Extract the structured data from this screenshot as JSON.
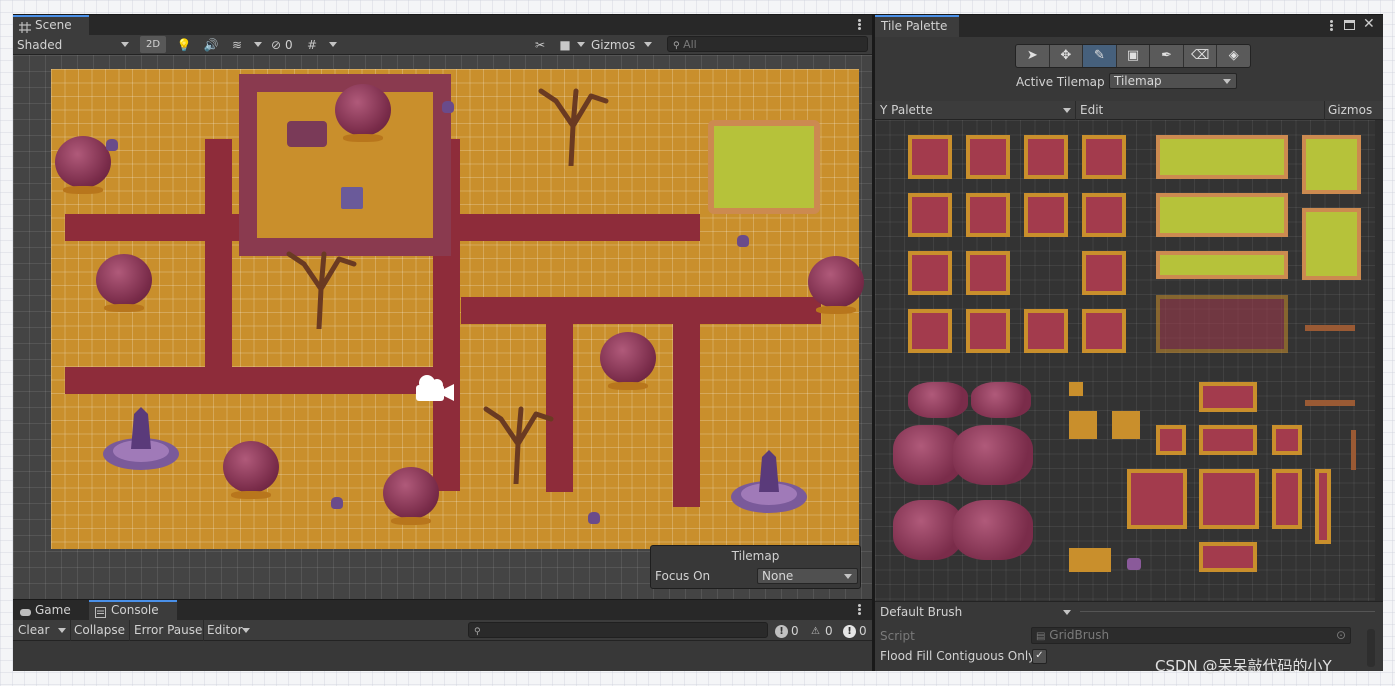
{
  "scene": {
    "tab_label": "Scene",
    "shading_mode": "Shaded",
    "btn_2d": "2D",
    "hidden_count": "0",
    "gizmos_label": "Gizmos",
    "search_placeholder": "All",
    "overlay": {
      "title": "Tilemap",
      "focus_label": "Focus On",
      "focus_value": "None"
    }
  },
  "console": {
    "tabs": [
      "Game",
      "Console"
    ],
    "clear": "Clear",
    "collapse": "Collapse",
    "error_pause": "Error Pause",
    "editor": "Editor",
    "log_count": "0",
    "warn_count": "0",
    "error_count": "0"
  },
  "tile_palette": {
    "tab_label": "Tile Palette",
    "tools": [
      "select-tool",
      "move-tool",
      "paint-tool",
      "box-fill-tool",
      "picker-tool",
      "erase-tool",
      "fill-tool"
    ],
    "active_tool_index": 2,
    "active_tilemap_label": "Active Tilemap",
    "active_tilemap_value": "Tilemap",
    "palette_value": "Y Palette",
    "edit_label": "Edit",
    "gizmos_label": "Gizmos",
    "brush_value": "Default Brush",
    "script_label": "Script",
    "script_value": "GridBrush",
    "flood_fill_label": "Flood Fill Contiguous Only",
    "flood_fill_checked": true
  },
  "watermark": "CSDN @呆呆敲代码的小Y",
  "colors": {
    "sand": "#c98f2c",
    "path": "#8e2c3a",
    "accent": "#4a90e8"
  }
}
